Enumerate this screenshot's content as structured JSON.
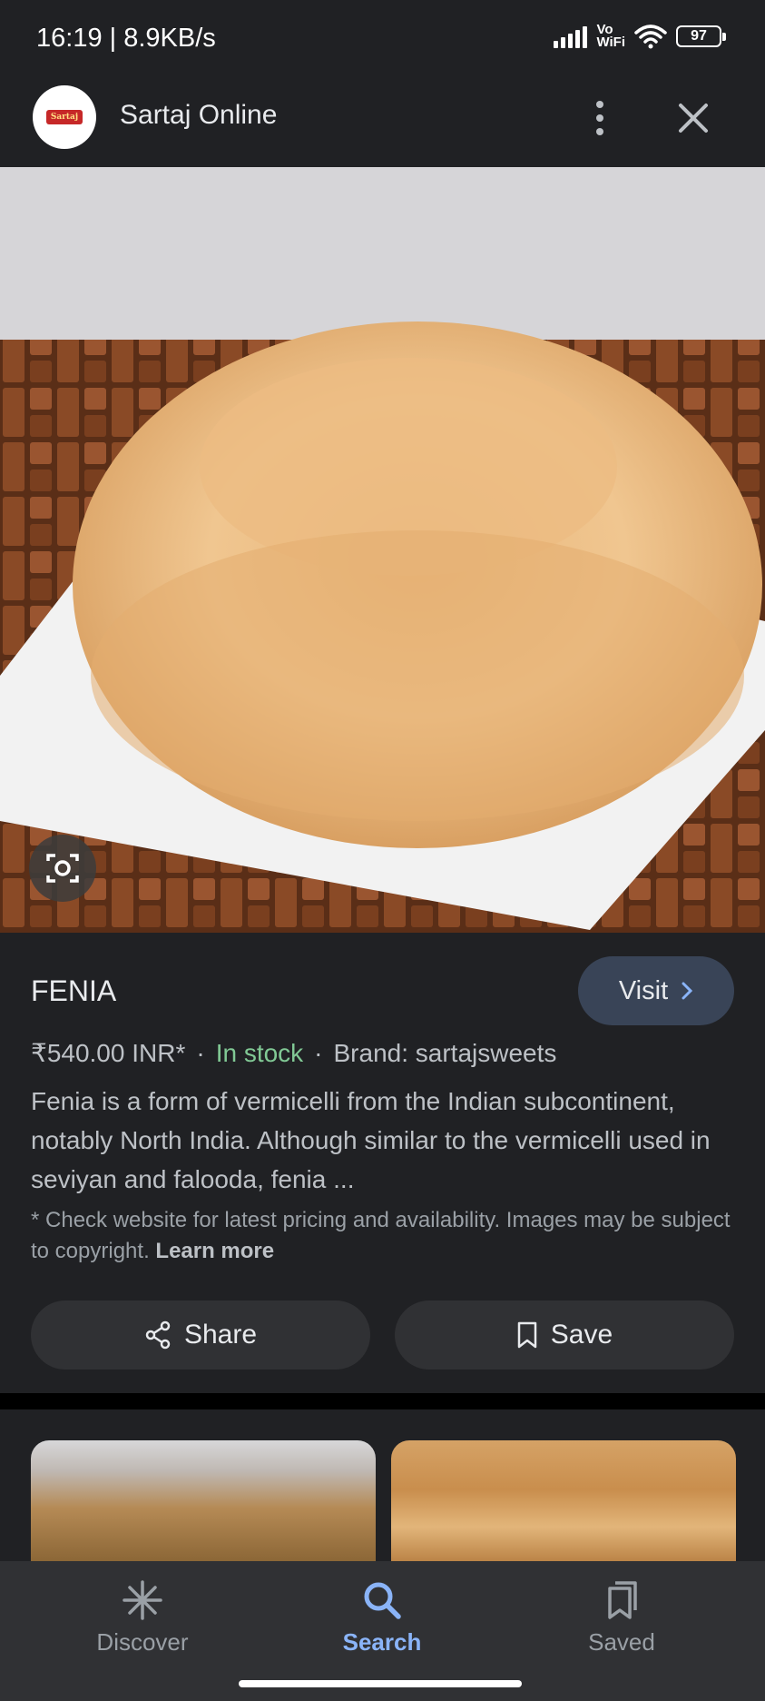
{
  "status_bar": {
    "time": "16:19 | 8.9KB/s",
    "network_label": "Vo\nWiFi",
    "battery": "97"
  },
  "header": {
    "logo_text": "Sartaj",
    "site_name": "Sartaj Online"
  },
  "product": {
    "title": "FENIA",
    "visit_label": "Visit",
    "price": "₹540.00 INR*",
    "stock": "In stock",
    "brand": "Brand: sartajsweets",
    "description": "Fenia is a form of vermicelli from the Indian subcontinent, notably North India. Although similar to the vermicelli used in seviyan and falooda, fenia ...",
    "note": "* Check website for latest pricing and availability. Images may be subject to copyright.",
    "learn_more": "Learn more",
    "share_label": "Share",
    "save_label": "Save"
  },
  "bottom_nav": {
    "items": [
      {
        "label": "Discover",
        "icon": "asterisk-icon"
      },
      {
        "label": "Search",
        "icon": "search-icon",
        "active": true
      },
      {
        "label": "Saved",
        "icon": "bookmarks-icon"
      }
    ]
  },
  "colors": {
    "background": "#202124",
    "accent": "#8ab4f8",
    "stock": "#81c995",
    "visit_button": "#394457"
  }
}
